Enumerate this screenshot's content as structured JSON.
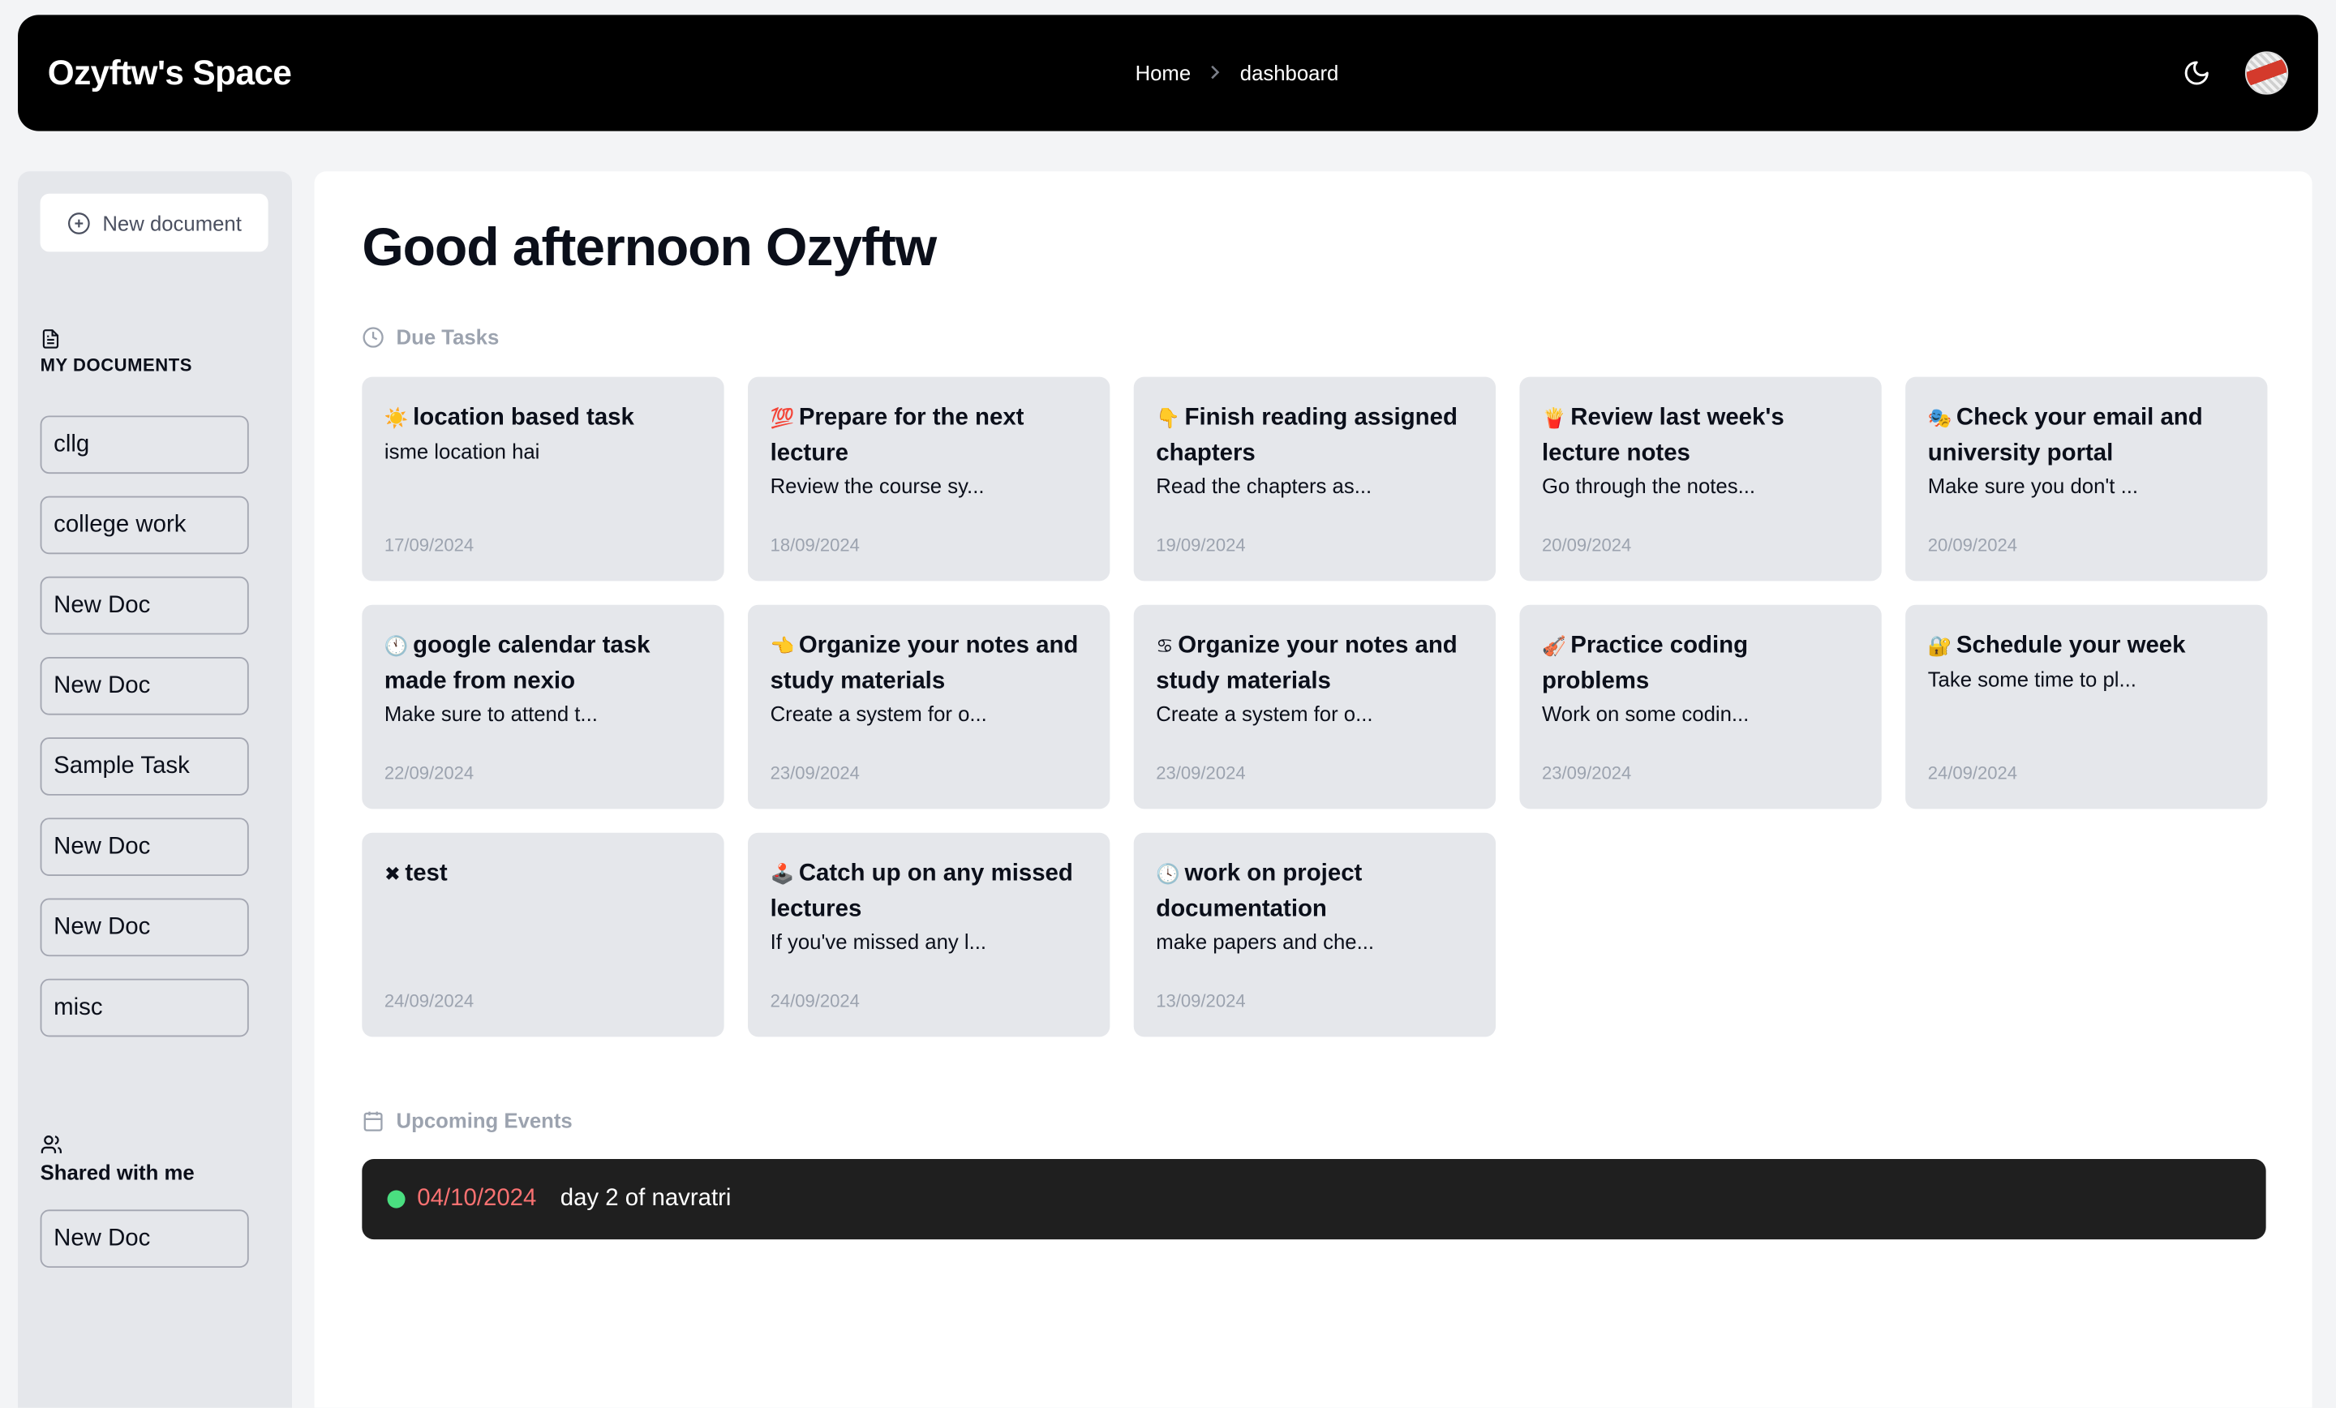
{
  "header": {
    "brand": "Ozyftw's Space",
    "breadcrumbs": [
      "Home",
      "dashboard"
    ],
    "theme_toggle_icon": "moon-icon",
    "avatar_icon": "user-avatar"
  },
  "sidebar": {
    "new_document_label": "New document",
    "my_documents_title": "MY DOCUMENTS",
    "my_documents": [
      "cllg",
      "college work",
      "New Doc",
      "New Doc",
      "Sample Task",
      "New Doc",
      "New Doc",
      "misc"
    ],
    "shared_title": "Shared with me",
    "shared_documents": [
      "New Doc"
    ]
  },
  "main": {
    "greeting": "Good afternoon Ozyftw",
    "due_tasks_label": "Due Tasks",
    "tasks": [
      {
        "emoji": "☀️",
        "title": "location based task",
        "desc": "isme location hai",
        "date": "17/09/2024"
      },
      {
        "emoji": "💯",
        "title": "Prepare for the next lecture",
        "desc": "Review the course sy...",
        "date": "18/09/2024"
      },
      {
        "emoji": "👇",
        "title": "Finish reading assigned chapters",
        "desc": "Read the chapters as...",
        "date": "19/09/2024"
      },
      {
        "emoji": "🍟",
        "title": "Review last week's lecture notes",
        "desc": "Go through the notes...",
        "date": "20/09/2024"
      },
      {
        "emoji": "🎭",
        "title": "Check your email and university portal",
        "desc": "Make sure you don't ...",
        "date": "20/09/2024"
      },
      {
        "emoji": "🕚",
        "title": "google calendar task made from nexio",
        "desc": "Make sure to attend t...",
        "date": "22/09/2024"
      },
      {
        "emoji": "👈",
        "title": "Organize your notes and study materials",
        "desc": "Create a system for o...",
        "date": "23/09/2024"
      },
      {
        "emoji": "♋",
        "title": "Organize your notes and study materials",
        "desc": "Create a system for o...",
        "date": "23/09/2024"
      },
      {
        "emoji": "🎻",
        "title": "Practice coding problems",
        "desc": "Work on some codin...",
        "date": "23/09/2024"
      },
      {
        "emoji": "🔐",
        "title": "Schedule your week",
        "desc": "Take some time to pl...",
        "date": "24/09/2024"
      },
      {
        "emoji": "✖",
        "title": "test",
        "desc": "",
        "date": "24/09/2024"
      },
      {
        "emoji": "🕹️",
        "title": "Catch up on any missed lectures",
        "desc": "If you've missed any l...",
        "date": "24/09/2024"
      },
      {
        "emoji": "🕓",
        "title": "work on project documentation",
        "desc": "make papers and che...",
        "date": "13/09/2024"
      }
    ],
    "upcoming_events_label": "Upcoming Events",
    "events": [
      {
        "date": "04/10/2024",
        "title": "day 2 of navratri",
        "status_color": "#4ade80"
      }
    ]
  }
}
